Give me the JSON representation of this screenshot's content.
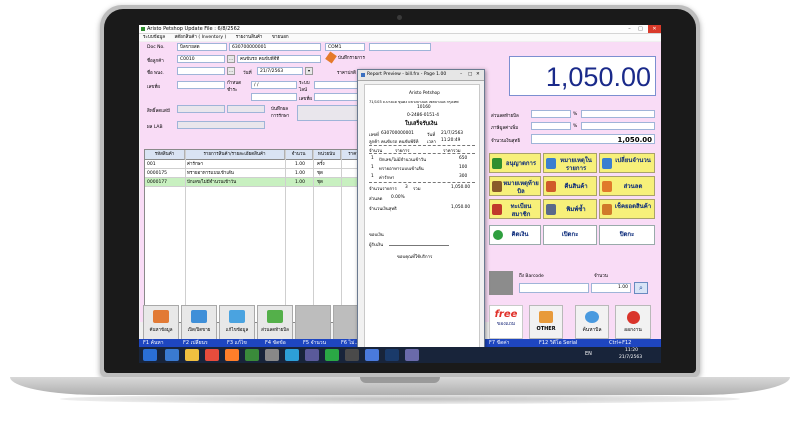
{
  "app": {
    "title": "Aristo Petshop Update File : 6/8/2562",
    "menu": [
      "ระบบข้อมูล",
      "สต๊อกสินค้า ( Inventory )",
      "รายงานสินค้า",
      "ขายนอก"
    ]
  },
  "form": {
    "doc_no_label": "Doc No.",
    "doc_type": "บิลขายสด",
    "doc_no": "630700000001",
    "machine": "COM1",
    "customer_code_label": "ชื่อลูกค้า",
    "customer_code": "C0010",
    "customer_name": "คนขับรถ คนขับพีจีที",
    "note_label": "บันทึกรายการ",
    "salesman_label": "ชื่อ พนง.",
    "date_label": "วันที่",
    "date": "21/7/2563",
    "price_label": "ราคาปกติ",
    "tax_label": "เลขที่ผ",
    "due_label": "กำหนดชำระ",
    "due": "/ /",
    "agent_label": "ระบบไลน์",
    "tax2_label": "เลขที่ผ",
    "discount_label": "ส่วนลดท้ายบิล",
    "member_label": "สิทธิ์ลดแต่มี",
    "lab_label": "ผล LAB",
    "record_label": "บันทึกผลการรักษา"
  },
  "grid": {
    "headers": [
      "รหัสสินค้า",
      "รายการสินค้า/รายละเอียดสินค้า",
      "จำนวน",
      "หน่วยนับ",
      "ราคา"
    ],
    "rows": [
      {
        "code": "001",
        "name": "ค่ารักษา",
        "qty": "1.00",
        "unit": "ครั้ง"
      },
      {
        "code": "0000175",
        "name": "ทรายอาหารแบบเข้าเส้น",
        "qty": "1.00",
        "unit": "ชุด"
      },
      {
        "code": "0000177",
        "name": "ปักเลข/ไม่มีจำนวนเข้าวัน",
        "qty": "1.00",
        "unit": "ชุด"
      }
    ]
  },
  "toolbar": {
    "search": "ค้นหาข้อมูล",
    "open_close": "เปิด/ปิดขาย",
    "edit": "แก้ไขข้อมูล",
    "discount": "ส่วนลดท้ายบิล"
  },
  "fkeys": [
    "F1 ค้นหา",
    "F2 เปลี่ยนร",
    "F3 แก้ไข",
    "F4 ขัดข้อ",
    "F5 จำนวน",
    "F6 ไม่...",
    "F7 ขีดค่า",
    "F11 ส่วนลด",
    "F12 วิดีโอ Serial",
    "ค้นหาในหน้าจอ",
    "Ctrl+F12"
  ],
  "right": {
    "total": "1,050.00",
    "disc_bill_label": "ส่วนลดท้ายบิล",
    "vat_label": "ภาษีมูลค่าเพิ่ม",
    "pct": "%",
    "net_label": "จำนวนเงินสุทธิ",
    "net": "1,050.00",
    "buttons": {
      "approve": "อนุญาตการ",
      "note": "หมายเหตุในรายการ",
      "change": "เปลี่ยนจำนวน",
      "note_bill": "หมายเหตุท้ายบิล",
      "return": "คืนสินค้า",
      "discount": "ส่วนลด",
      "register": "ทะเบียนสมาชิก",
      "print": "พิมพ์ซ้ำ",
      "check": "เช็คยอดสินค้า",
      "cash": "คิดเงิน",
      "open": "เปิดกะ",
      "close": "ปิดกะ"
    },
    "barcode_label": "ถึง Barcode",
    "qty_label": "จำนวน",
    "qty": "1.00",
    "free_label": "free",
    "gift_label": "ของแถม",
    "other_label": "OTHER",
    "find_label": "ค้นหาบิล",
    "exit_label": "ออกงาน"
  },
  "popup": {
    "title": "Report Preview - bill.frx - Page 1.00",
    "shop": "Aristo Petshop",
    "address1": "71/103 ถ.บางแค ขุนคง แขวงบางแค เขตบางแค กรุงเทพ",
    "address2": "10160",
    "phone": "0-2486-0151-4",
    "doc_title": "ใบเสร็จรับเงิน",
    "doc_no_label": "เลขที่",
    "doc_no": "630700000001",
    "date_label": "วันที่",
    "date": "21/7/2563",
    "cust_label": "ลูกค้า",
    "cust": "คนขับรถ คนขับพีจีที",
    "time_label": "เวลา",
    "time": "11:20:49",
    "col_qty": "จำนวน",
    "col_item": "รายการ",
    "col_price": "ราคารวม",
    "items": [
      {
        "qty": "1",
        "name": "ปักเลข/ไม่มีจำนวนเข้าวัน",
        "price": "650"
      },
      {
        "qty": "1",
        "name": "ทรายอาหารแบบเข้าเส้น",
        "price": "100"
      },
      {
        "qty": "1",
        "name": "ค่ารักษา",
        "price": "300"
      }
    ],
    "count_label": "จำนวนรายการ",
    "count": "3",
    "sum_label": "รวม",
    "sum": "1,050.00",
    "discount_label": "ส่วนลด",
    "discount": "0.00%",
    "net_label": "จำนวนเงินสุทธิ",
    "net": "1,050.00",
    "cashier_label": "ขอบเงิน",
    "signature_label": "ผู้รับเงิน",
    "thanks": "ขอบคุณที่ใช้บริการ"
  },
  "taskbar": {
    "lang": "EN",
    "time": "11:20",
    "date": "21/7/2563"
  }
}
